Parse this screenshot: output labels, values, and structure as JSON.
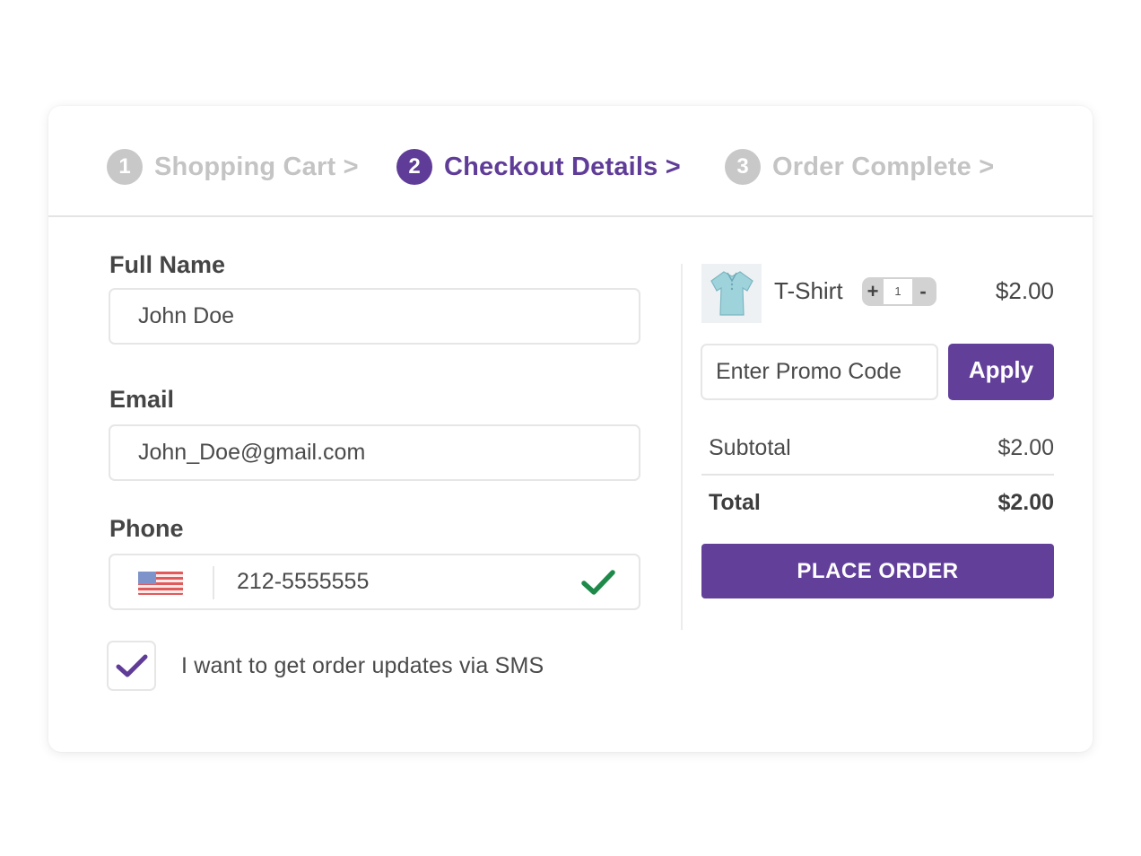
{
  "steps": [
    {
      "number": "1",
      "label": "Shopping Cart >",
      "state": "inactive"
    },
    {
      "number": "2",
      "label": "Checkout Details >",
      "state": "active"
    },
    {
      "number": "3",
      "label": "Order Complete >",
      "state": "inactive"
    }
  ],
  "form": {
    "full_name": {
      "label": "Full Name",
      "value": "John Doe"
    },
    "email": {
      "label": "Email",
      "value": "John_Doe@gmail.com"
    },
    "phone": {
      "label": "Phone",
      "value": "212-5555555",
      "country_flag": "us-flag-icon",
      "valid": true
    },
    "sms_opt_in": {
      "label": "I want to get order updates via SMS",
      "checked": true
    }
  },
  "order": {
    "item": {
      "name": "T-Shirt",
      "quantity": "1",
      "price": "$2.00",
      "increase_label": "+",
      "decrease_label": "-"
    },
    "promo": {
      "placeholder": "Enter Promo Code",
      "apply_label": "Apply"
    },
    "subtotal": {
      "label": "Subtotal",
      "value": "$2.00"
    },
    "total": {
      "label": "Total",
      "value": "$2.00"
    },
    "place_order_label": "PLACE ORDER"
  },
  "colors": {
    "accent": "#62409a",
    "inactive_step": "#c4c4c4",
    "valid_check": "#1e8a4a"
  }
}
